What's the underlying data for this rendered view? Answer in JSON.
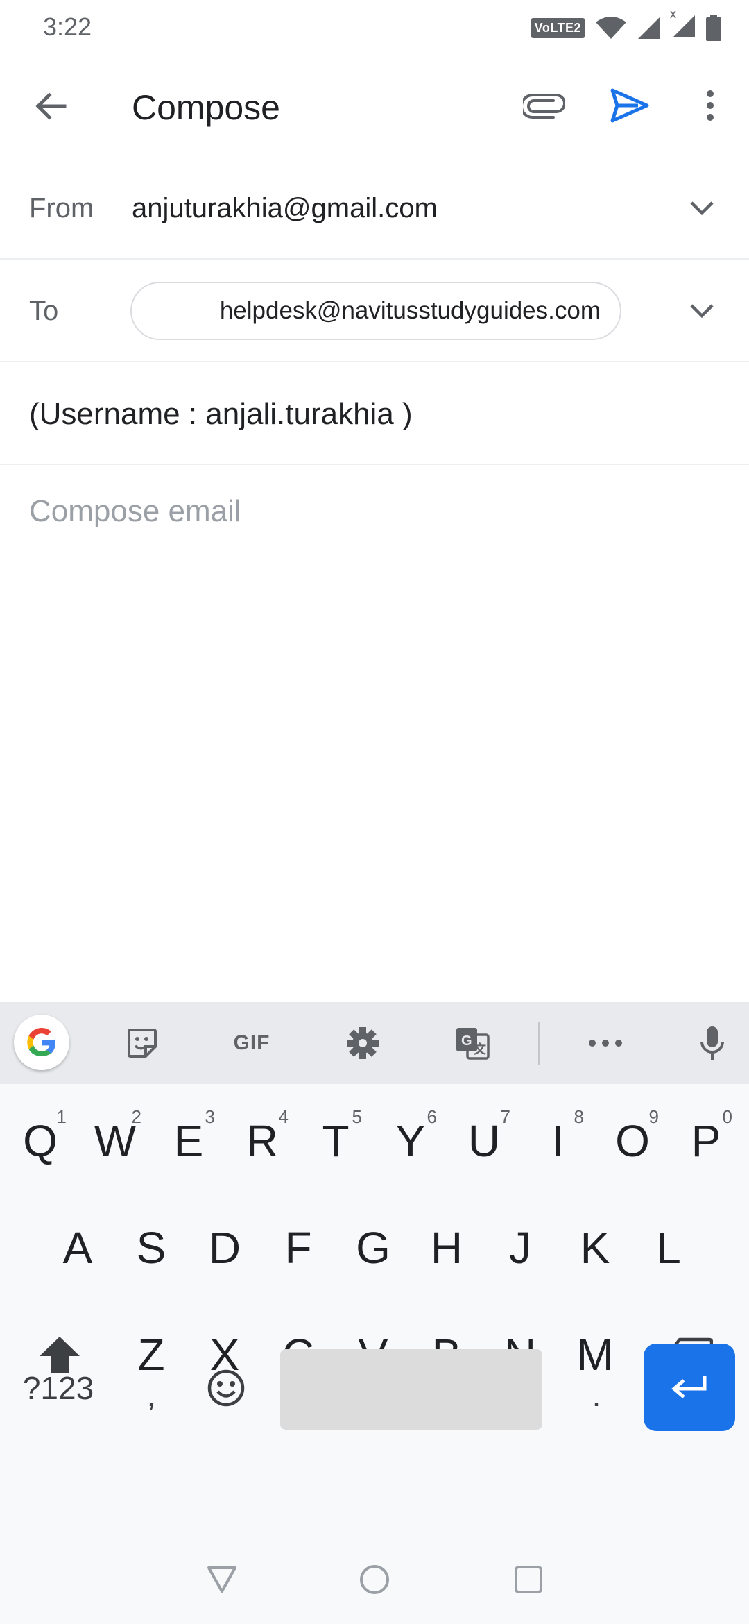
{
  "status_bar": {
    "time": "3:22",
    "volte_label": "VoLTE2",
    "roaming_mark": "x",
    "icons": [
      "volte-icon",
      "wifi-icon",
      "signal-icon",
      "signal-icon",
      "battery-icon"
    ]
  },
  "app_bar": {
    "title": "Compose",
    "back_icon": "arrow-back-icon",
    "attach_icon": "paperclip-icon",
    "send_icon": "send-icon",
    "more_icon": "more-vert-icon",
    "accent_color": "#1a73e8"
  },
  "from_field": {
    "label": "From",
    "value": "anjuturakhia@gmail.com"
  },
  "to_field": {
    "label": "To",
    "recipient": "helpdesk@navitusstudyguides.com"
  },
  "subject_field": {
    "value": "(Username : anjali.turakhia )"
  },
  "body_field": {
    "placeholder": "Compose email"
  },
  "keyboard": {
    "toolbar": {
      "gif_label": "GIF",
      "icons": [
        "google-icon",
        "sticker-icon",
        "gif-icon",
        "settings-icon",
        "translate-icon",
        "more-horiz-icon",
        "mic-icon"
      ]
    },
    "row1": [
      {
        "key": "Q",
        "hint": "1"
      },
      {
        "key": "W",
        "hint": "2"
      },
      {
        "key": "E",
        "hint": "3"
      },
      {
        "key": "R",
        "hint": "4"
      },
      {
        "key": "T",
        "hint": "5"
      },
      {
        "key": "Y",
        "hint": "6"
      },
      {
        "key": "U",
        "hint": "7"
      },
      {
        "key": "I",
        "hint": "8"
      },
      {
        "key": "O",
        "hint": "9"
      },
      {
        "key": "P",
        "hint": "0"
      }
    ],
    "row2": [
      "A",
      "S",
      "D",
      "F",
      "G",
      "H",
      "J",
      "K",
      "L"
    ],
    "row3": [
      "Z",
      "X",
      "C",
      "V",
      "B",
      "N",
      "M"
    ],
    "symbols_key": "?123",
    "comma_key": ",",
    "period_key": ".",
    "enter_color": "#1a73e8"
  },
  "nav_bar": {
    "icons": [
      "back-triangle-icon",
      "home-circle-icon",
      "recents-square-icon"
    ]
  }
}
